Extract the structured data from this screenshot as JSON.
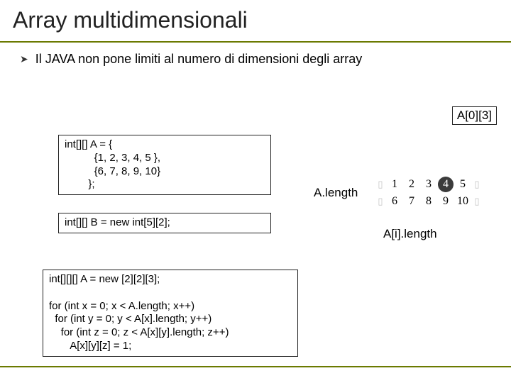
{
  "title": "Array multidimensionali",
  "bullet": {
    "glyph": "➤",
    "text": "Il JAVA non pone limiti al numero di dimensioni degli array"
  },
  "corner_label": "A[0][3]",
  "code1": "int[][] A = {\n          {1, 2, 3, 4, 5 },\n          {6, 7, 8, 9, 10}\n        };",
  "code2": "int[][] B = new int[5][2];",
  "code3": "int[][][] A = new [2][2][3];\n\nfor (int x = 0; x < A.length; x++)\n  for (int y = 0; y < A[x].length; y++)\n    for (int z = 0; z < A[x][y].length; z++)\n       A[x][y][z] = 1;",
  "alen_label": "A.length",
  "ailen_label": "A[i].length",
  "grid": {
    "row0": {
      "g0": "▯",
      "c1": "1",
      "c2": "2",
      "c3": "3",
      "c4": "4",
      "c5": "5",
      "g1": "▯"
    },
    "row1": {
      "g0": "▯",
      "c1": "6",
      "c2": "7",
      "c3": "8",
      "c4": "9",
      "c5": "10",
      "g1": "▯"
    }
  }
}
